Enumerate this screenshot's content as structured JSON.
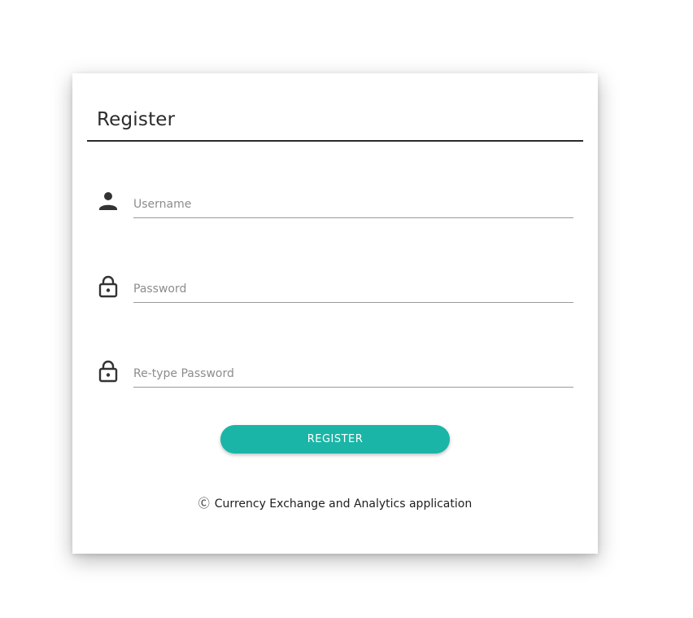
{
  "form": {
    "title": "Register",
    "fields": [
      {
        "placeholder": "Username",
        "value": "",
        "icon": "person-icon"
      },
      {
        "placeholder": "Password",
        "value": "",
        "icon": "lock-icon"
      },
      {
        "placeholder": "Re-type Password",
        "value": "",
        "icon": "lock-icon"
      }
    ],
    "submit_label": "REGISTER"
  },
  "footer": {
    "copyright_symbol": "Ⓒ",
    "text": "Currency Exchange and Analytics application"
  },
  "colors": {
    "accent": "#1ab5a6",
    "title_text": "#2b2b2b",
    "underline": "#9a9a9a"
  }
}
